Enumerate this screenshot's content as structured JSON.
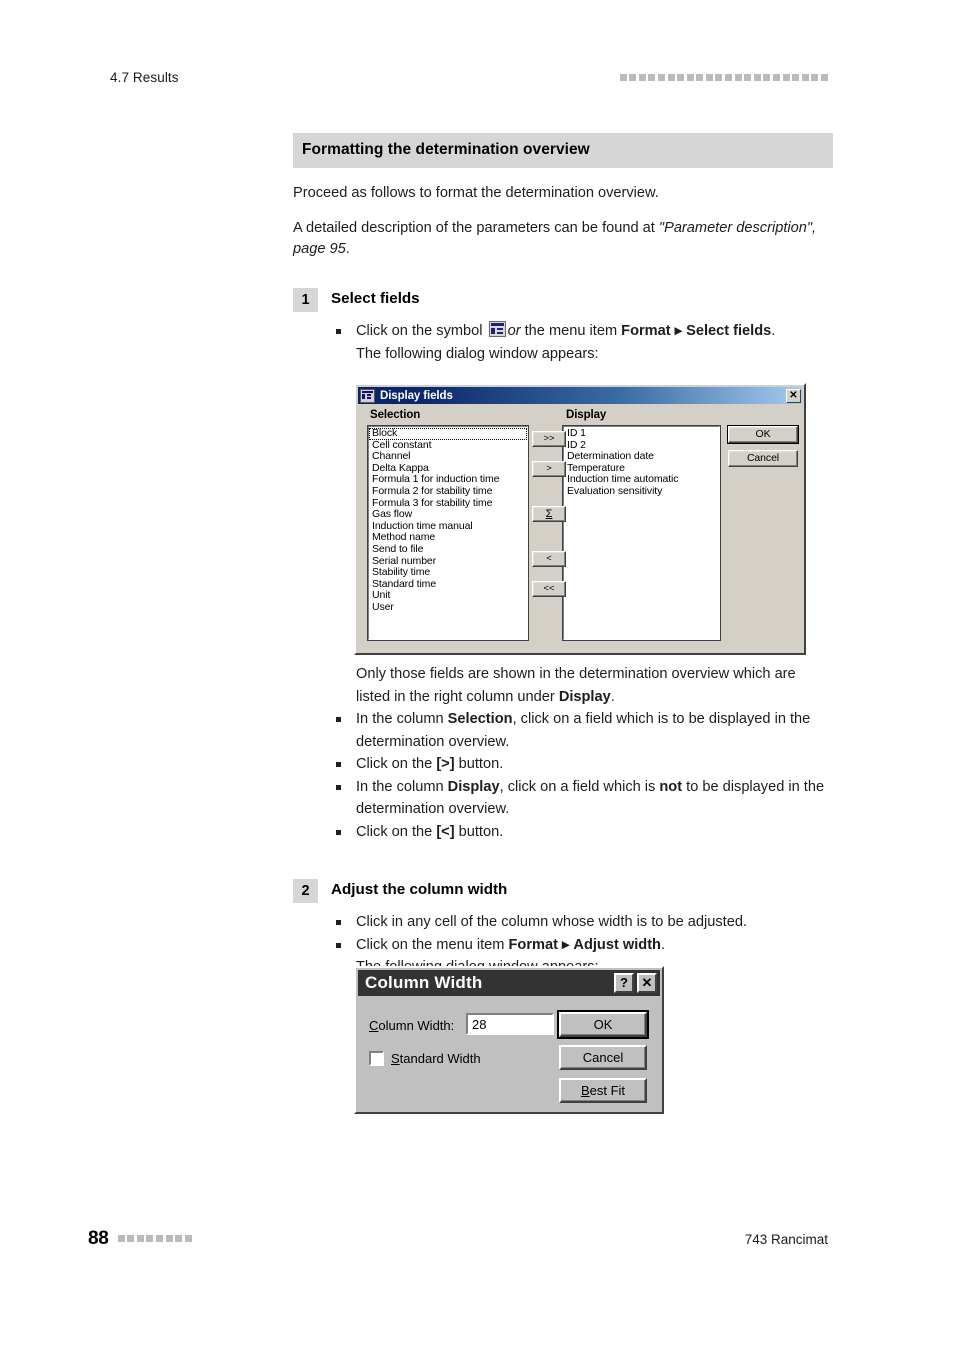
{
  "header": {
    "section_ref": "4.7 Results",
    "decor_square_count": 22
  },
  "content": {
    "section_title": "Formatting the determination overview",
    "intro_1": "Proceed as follows to format the determination overview.",
    "intro_2_plain": "A detailed description of the parameters can be found at ",
    "intro_2_italic": "\"Parameter description\", page 95",
    "intro_2_end": "."
  },
  "step1": {
    "number": "1",
    "title": "Select fields",
    "bullet1_pre": "Click on the symbol ",
    "bullet1_icon": "select-fields-toolbar-icon",
    "bullet1_mid": " the menu item ",
    "bullet1_or": "or",
    "bullet1_menu": "Format",
    "bullet1_arrow": "▸",
    "bullet1_item": "Select fields",
    "bullet1_end": ".",
    "follow_text": "The following dialog window appears:",
    "after_dialog_line1": "Only those fields are shown in the determination overview which are listed in the right column under ",
    "after_dialog_bold": "Display",
    "after_dialog_end": ".",
    "bullets": [
      {
        "pre": "In the column ",
        "bold": "Selection",
        "post": ", click on a field which is to be displayed in the determination overview."
      },
      {
        "pre": "Click on the ",
        "bold": "[>]",
        "post": " button."
      },
      {
        "pre": "In the column ",
        "bold": "Display",
        "mid": ", click on a field which is ",
        "bold2": "not",
        "post": " to be displayed in the determination overview."
      },
      {
        "pre": "Click on the ",
        "bold": "[<]",
        "post": " button."
      }
    ]
  },
  "display_fields_dialog": {
    "title": "Display fields",
    "title_icon": "table-grid-icon",
    "close_label": "✕",
    "selection_label": "Selection",
    "display_label": "Display",
    "selection_items": [
      "Block",
      "Cell constant",
      "Channel",
      "Delta Kappa",
      "Formula 1 for induction time",
      "Formula 2 for stability time",
      "Formula 3 for stability time",
      "Gas flow",
      "Induction time manual",
      "Method name",
      "Send to file",
      "Serial number",
      "Stability time",
      "Standard time",
      "Unit",
      "User"
    ],
    "selection_focused_index": 0,
    "display_items": [
      "ID 1",
      "ID 2",
      "Determination date",
      "Temperature",
      "Induction time automatic",
      "Evaluation sensitivity"
    ],
    "transfer_buttons": [
      {
        "label": ">>",
        "name": "move-all-right-button"
      },
      {
        "label": ">",
        "name": "move-right-button"
      },
      {
        "label": "Σ",
        "name": "sum-button"
      },
      {
        "label": "<",
        "name": "move-left-button"
      },
      {
        "label": "<<",
        "name": "move-all-left-button"
      }
    ],
    "ok_label": "OK",
    "cancel_label": "Cancel"
  },
  "step2": {
    "number": "2",
    "title": "Adjust the column width",
    "bullets": [
      {
        "text": "Click in any cell of the column whose width is to be adjusted."
      }
    ],
    "bullet2_pre": "Click on the menu item ",
    "bullet2_menu": "Format",
    "bullet2_arrow": "▸",
    "bullet2_item": "Adjust width",
    "bullet2_end": ".",
    "follow_text": "The following dialog window appears:"
  },
  "column_width_dialog": {
    "title": "Column Width",
    "help_label": "?",
    "close_label": "✕",
    "field_label_accel": "C",
    "field_label_rest": "olumn Width:",
    "field_value": "28",
    "checkbox_label_accel": "S",
    "checkbox_label_rest": "tandard Width",
    "checkbox_checked": false,
    "ok_label": "OK",
    "cancel_label": "Cancel",
    "bestfit_accel": "B",
    "bestfit_rest": "est Fit"
  },
  "footer": {
    "page_number": "88",
    "decor_square_count": 8,
    "product": "743 Rancimat"
  }
}
